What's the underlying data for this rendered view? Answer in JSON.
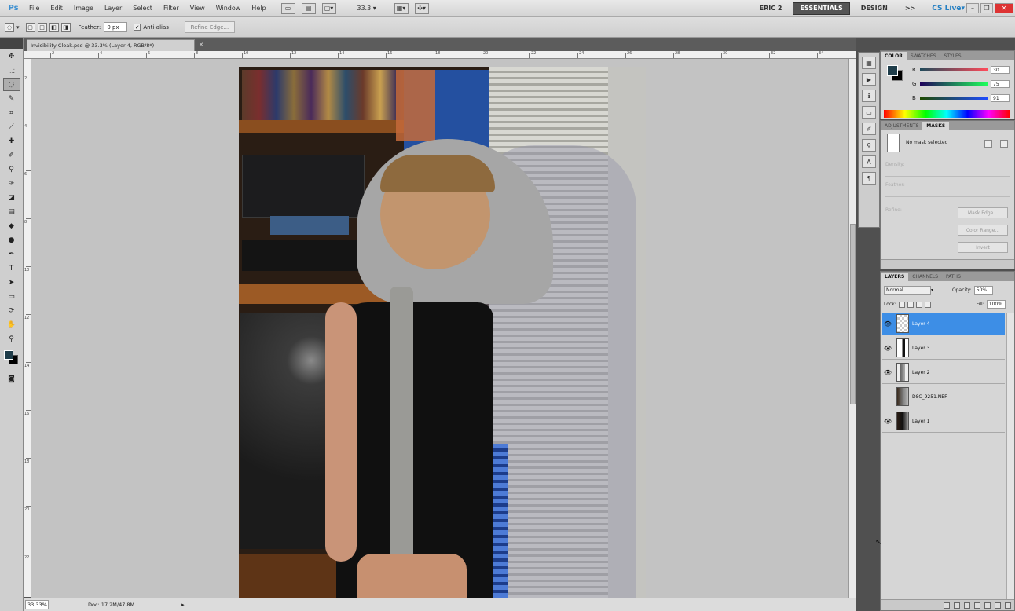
{
  "app": {
    "logo": "Ps"
  },
  "menu": [
    "File",
    "Edit",
    "Image",
    "Layer",
    "Select",
    "Filter",
    "View",
    "Window",
    "Help"
  ],
  "menubar": {
    "icons": [
      "br-icon",
      "mb-icon",
      "screen-mode-icon"
    ],
    "zoom": "33.3",
    "arrange_icons": [
      "arrange-icon",
      "extras-icon"
    ],
    "workspaces": [
      "ERIC 2",
      "ESSENTIALS",
      "DESIGN"
    ],
    "more": ">>",
    "cs_live": "CS Live"
  },
  "options": {
    "feather_label": "Feather:",
    "feather_value": "0 px",
    "anti_alias_label": "Anti-alias",
    "refine_edge": "Refine Edge..."
  },
  "document": {
    "tab_title": "Invisibility Cloak.psd @ 33.3% (Layer 4, RGB/8*)",
    "zoom_percent": "33.33%",
    "doc_size": "Doc: 17.2M/47.8M"
  },
  "ruler": {
    "top_numbers": [
      "2",
      "4",
      "6",
      "8",
      "10",
      "12",
      "14",
      "16",
      "18",
      "20",
      "22",
      "24",
      "26",
      "28",
      "30",
      "32",
      "34"
    ],
    "left_numbers": [
      "2",
      "4",
      "6",
      "8",
      "10",
      "12",
      "14",
      "16",
      "18",
      "20",
      "22"
    ]
  },
  "tools": [
    "move-tool",
    "marquee-tool",
    "lasso-tool",
    "quick-select-tool",
    "crop-tool",
    "eyedropper-tool",
    "healing-tool",
    "brush-tool",
    "clone-stamp-tool",
    "history-brush-tool",
    "eraser-tool",
    "gradient-tool",
    "blur-tool",
    "dodge-tool",
    "pen-tool",
    "type-tool",
    "path-select-tool",
    "shape-tool",
    "3d-rotate-tool",
    "3d-orbit-tool",
    "hand-tool",
    "zoom-tool"
  ],
  "colors": {
    "foreground": "#1f3d4a",
    "background": "#000000",
    "selected_layer": "#3d8ee6"
  },
  "color_panel": {
    "tabs": [
      "COLOR",
      "SWATCHES",
      "STYLES"
    ],
    "r": "30",
    "g": "75",
    "b": "91"
  },
  "masks_panel": {
    "tabs": [
      "ADJUSTMENTS",
      "MASKS"
    ],
    "status": "No mask selected",
    "density_label": "Density:",
    "feather_label": "Feather:",
    "refine_label": "Refine:",
    "mask_edge": "Mask Edge...",
    "color_range": "Color Range...",
    "invert": "Invert"
  },
  "layers_panel": {
    "tabs": [
      "LAYERS",
      "CHANNELS",
      "PATHS"
    ],
    "blend_mode": "Normal",
    "opacity_label": "Opacity:",
    "opacity": "50%",
    "lock_label": "Lock:",
    "fill_label": "Fill:",
    "fill": "100%",
    "layers": [
      {
        "name": "Layer 4",
        "selected": true,
        "visible": true
      },
      {
        "name": "Layer 3",
        "selected": false,
        "visible": true
      },
      {
        "name": "Layer 2",
        "selected": false,
        "visible": true
      },
      {
        "name": "DSC_9251.NEF",
        "selected": false,
        "visible": false
      },
      {
        "name": "Layer 1",
        "selected": false,
        "visible": true
      }
    ]
  }
}
